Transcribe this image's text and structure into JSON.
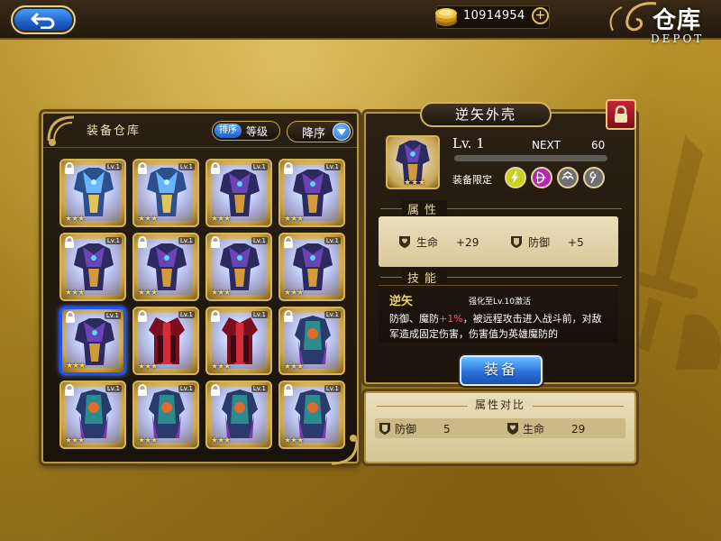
{
  "header": {
    "back_icon": "back-arrow-icon",
    "coins": "10914954",
    "coin_add": "+",
    "title": "仓库",
    "subtitle": "DEPOT"
  },
  "warehouse": {
    "title": "装备仓库",
    "sort_badge": "排序",
    "sort_value": "等级",
    "order_label": "降序",
    "items": [
      {
        "lv": "Lv.1",
        "stars": "★★★",
        "locked": true,
        "art": "blue-armor",
        "selected": false
      },
      {
        "lv": "Lv.1",
        "stars": "★★★",
        "locked": true,
        "art": "blue-armor",
        "selected": false
      },
      {
        "lv": "Lv.1",
        "stars": "★★★",
        "locked": true,
        "art": "dark-armor",
        "selected": false
      },
      {
        "lv": "Lv.1",
        "stars": "★★★",
        "locked": true,
        "art": "dark-armor",
        "selected": false
      },
      {
        "lv": "Lv.1",
        "stars": "★★★",
        "locked": true,
        "art": "dark-armor",
        "selected": false
      },
      {
        "lv": "Lv.1",
        "stars": "★★★",
        "locked": true,
        "art": "dark-armor",
        "selected": false
      },
      {
        "lv": "Lv.1",
        "stars": "★★★",
        "locked": true,
        "art": "dark-armor",
        "selected": false
      },
      {
        "lv": "Lv.1",
        "stars": "★★★",
        "locked": true,
        "art": "dark-armor",
        "selected": false
      },
      {
        "lv": "Lv.1",
        "stars": "★★★",
        "locked": true,
        "art": "dark-armor",
        "selected": true
      },
      {
        "lv": "Lv.1",
        "stars": "★★★",
        "locked": true,
        "art": "red-robe",
        "selected": false
      },
      {
        "lv": "Lv.1",
        "stars": "★★★",
        "locked": true,
        "art": "red-robe",
        "selected": false
      },
      {
        "lv": "Lv.1",
        "stars": "★★★",
        "locked": true,
        "art": "teal-robe",
        "selected": false
      },
      {
        "lv": "Lv.1",
        "stars": "★★★",
        "locked": true,
        "art": "teal-robe",
        "selected": false
      },
      {
        "lv": "Lv.1",
        "stars": "★★★",
        "locked": true,
        "art": "teal-robe",
        "selected": false
      },
      {
        "lv": "Lv.1",
        "stars": "★★★",
        "locked": true,
        "art": "teal-robe",
        "selected": false
      },
      {
        "lv": "Lv.1",
        "stars": "★★★",
        "locked": true,
        "art": "teal-robe",
        "selected": false
      }
    ]
  },
  "detail": {
    "name": "逆矢外壳",
    "stars": "★★★",
    "level": "Lv. 1",
    "next_label": "NEXT",
    "next_value": "60",
    "exp_progress": 0,
    "restrict_label": "装备限定",
    "class_icons": [
      {
        "icon": "lightning-icon",
        "color": "#c8d21c"
      },
      {
        "icon": "bow-icon",
        "color": "#b526b5"
      },
      {
        "icon": "wave-icon",
        "color": "#6f6f6f"
      },
      {
        "icon": "swirl-icon",
        "color": "#6f6f6f"
      }
    ],
    "attr_title": "属性",
    "attrs": [
      {
        "label": "生命",
        "value": "+29"
      },
      {
        "label": "防御",
        "value": "+5"
      }
    ],
    "skill_title": "技能",
    "skill_name": "逆矢",
    "skill_enhance": "强化至Lv.10激活",
    "skill_desc_1": "防御、魔防",
    "skill_desc_hl": "+1%",
    "skill_desc_2": "，被远程攻击进入战斗前，对敌军造成固定伤害，伤害值为英雄魔防的",
    "equip_label": "装备"
  },
  "compare": {
    "title": "属性对比",
    "items": [
      {
        "label": "防御",
        "value": "5"
      },
      {
        "label": "生命",
        "value": "29"
      }
    ]
  },
  "colors": {
    "accent_blue": "#2b73dc",
    "gold_border": "#b8953f",
    "highlight_red": "#ff5a6e"
  }
}
